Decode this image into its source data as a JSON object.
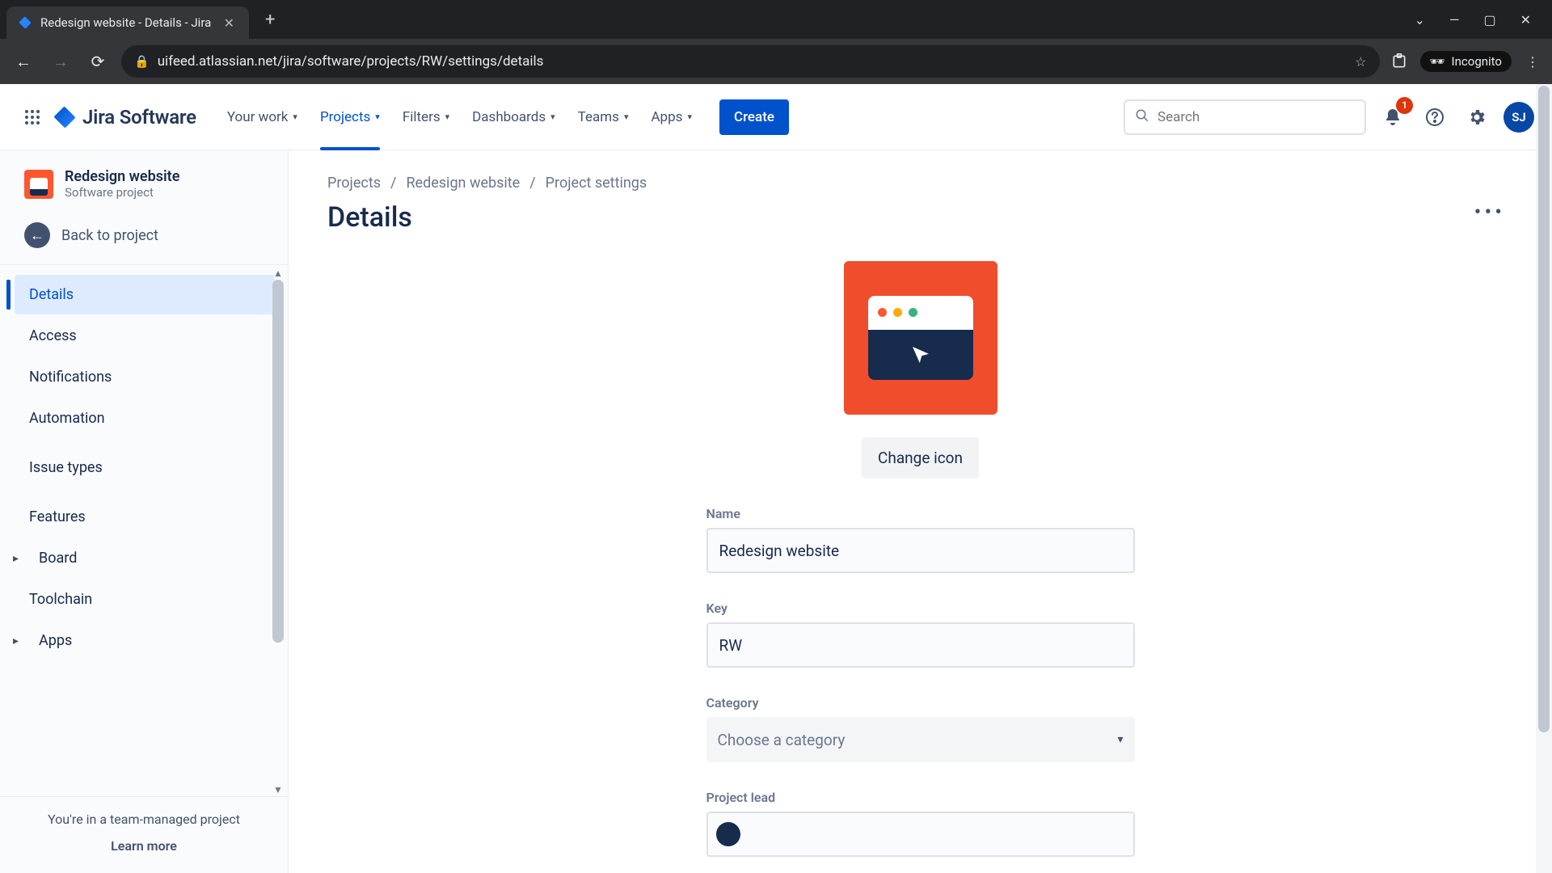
{
  "browser": {
    "tab_title": "Redesign website - Details - Jira",
    "url": "uifeed.atlassian.net/jira/software/projects/RW/settings/details",
    "incognito_label": "Incognito"
  },
  "topbar": {
    "product_name": "Jira Software",
    "nav": {
      "your_work": "Your work",
      "projects": "Projects",
      "filters": "Filters",
      "dashboards": "Dashboards",
      "teams": "Teams",
      "apps": "Apps"
    },
    "create_label": "Create",
    "search_placeholder": "Search",
    "notification_count": "1",
    "avatar_initials": "SJ"
  },
  "sidebar": {
    "project_name": "Redesign website",
    "project_type": "Software project",
    "back_label": "Back to project",
    "items": {
      "details": "Details",
      "access": "Access",
      "notifications": "Notifications",
      "automation": "Automation",
      "issue_types": "Issue types",
      "features": "Features",
      "board": "Board",
      "toolchain": "Toolchain",
      "apps": "Apps"
    },
    "footer_line1": "You're in a team-managed project",
    "footer_learn_more": "Learn more"
  },
  "breadcrumbs": {
    "projects": "Projects",
    "project": "Redesign website",
    "settings": "Project settings"
  },
  "page": {
    "title": "Details",
    "change_icon_label": "Change icon",
    "name_label": "Name",
    "name_value": "Redesign website",
    "key_label": "Key",
    "key_value": "RW",
    "category_label": "Category",
    "category_placeholder": "Choose a category",
    "lead_label": "Project lead"
  },
  "colors": {
    "accent": "#0052cc",
    "icon_bg": "#f04d2d",
    "dot_red": "#ff5630",
    "dot_yellow": "#ffab00",
    "dot_green": "#36b37e"
  }
}
